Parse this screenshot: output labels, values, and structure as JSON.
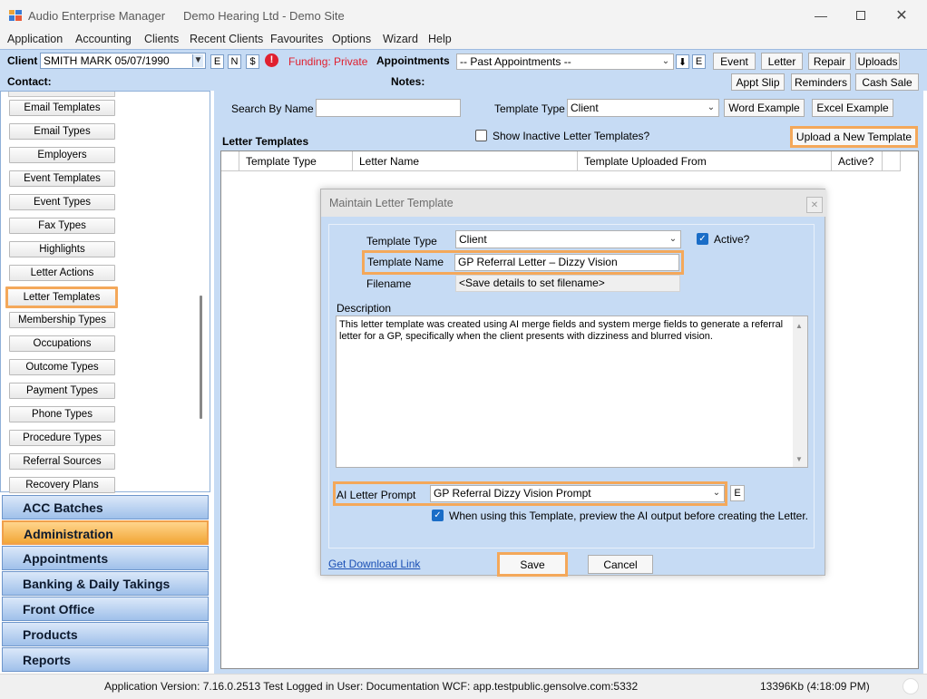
{
  "window": {
    "app_title": "Audio Enterprise Manager",
    "site_title": "Demo Hearing Ltd - Demo Site",
    "min_icon": "minimize-icon",
    "max_icon": "maximize-icon",
    "close_icon": "close-icon"
  },
  "menu": [
    "Application",
    "Accounting",
    "Clients",
    "Recent Clients",
    "Favourites",
    "Options",
    "Wizard",
    "Help"
  ],
  "toolbar": {
    "client_label": "Client",
    "client_value": "SMITH MARK 05/07/1990",
    "btn_e": "E",
    "btn_n": "N",
    "btn_dollar": "$",
    "funding_text": "Funding: Private",
    "funding_color": "#e0202f",
    "appointments_label": "Appointments",
    "appointments_value": "-- Past Appointments --",
    "appt_e": "E",
    "event": "Event",
    "letter": "Letter",
    "repair": "Repair",
    "uploads": "Uploads",
    "contact_label": "Contact:",
    "notes_label": "Notes:",
    "appt_slip": "Appt Slip",
    "reminders": "Reminders",
    "cash_sale": "Cash Sale"
  },
  "sidebar": {
    "items": [
      "Email Templates",
      "Email Types",
      "Employers",
      "Event Templates",
      "Event Types",
      "Fax Types",
      "Highlights",
      "Letter Actions",
      "Letter Templates",
      "Membership Types",
      "Occupations",
      "Outcome Types",
      "Payment Types",
      "Phone Types",
      "Procedure Types",
      "Referral Sources",
      "Recovery Plans"
    ],
    "selected_item": "Letter Templates",
    "groups": [
      "ACC Batches",
      "Administration",
      "Appointments",
      "Banking & Daily Takings",
      "Front Office",
      "Products",
      "Reports"
    ],
    "selected_group": "Administration"
  },
  "search": {
    "by_name_label": "Search By Name",
    "by_name_value": "",
    "template_type_label": "Template Type",
    "template_type_value": "Client",
    "word_example": "Word Example",
    "excel_example": "Excel Example",
    "section_title": "Letter Templates",
    "show_inactive_label": "Show Inactive Letter Templates?",
    "upload_new": "Upload a New Template"
  },
  "grid": {
    "columns": [
      "Template Type",
      "Letter Name",
      "Template Uploaded From",
      "Active?"
    ]
  },
  "dialog": {
    "title": "Maintain Letter Template",
    "template_type_label": "Template Type",
    "template_type_value": "Client",
    "active_label": "Active?",
    "template_name_label": "Template Name",
    "template_name_value": "GP Referral Letter – Dizzy Vision",
    "filename_label": "Filename",
    "filename_value": "<Save details to set filename>",
    "description_label": "Description",
    "description_value": "This letter template was created using AI merge fields and system merge fields to generate a referral letter for a GP, specifically when the client presents with dizziness and blurred vision.",
    "ai_prompt_label": "AI Letter Prompt",
    "ai_prompt_value": "GP Referral Dizzy Vision Prompt",
    "ai_prompt_e": "E",
    "preview_label": "When using this Template, preview the AI output before creating the Letter.",
    "download_link": "Get Download Link",
    "save": "Save",
    "cancel": "Cancel"
  },
  "status": {
    "left_text": "Application Version: 7.16.0.2513 Test  Logged in User: Documentation WCF: app.testpublic.gensolve.com:5332",
    "right_text": "13396Kb  (4:18:09 PM)"
  },
  "colors": {
    "highlight": "#f4a85a",
    "panel_blue": "#c6dbf4",
    "check_blue": "#1a6dc7"
  }
}
